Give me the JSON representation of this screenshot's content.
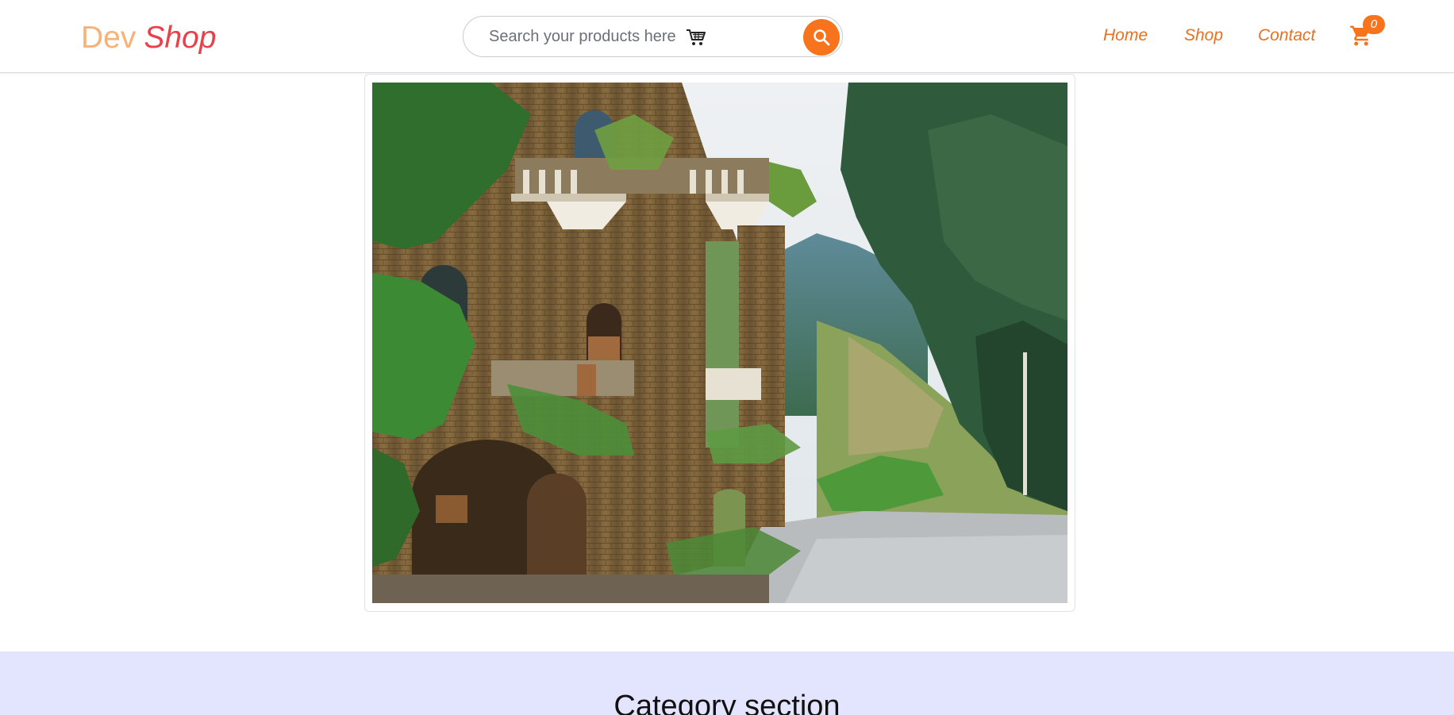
{
  "brand": {
    "part1": "Dev",
    "part2": "Shop"
  },
  "search": {
    "placeholder": "Search your products here",
    "cart_icon": "shopping-cart-icon",
    "button_icon": "search-icon"
  },
  "nav": {
    "links": [
      {
        "label": "Home"
      },
      {
        "label": "Shop"
      },
      {
        "label": "Contact"
      }
    ],
    "cart_icon": "cart-icon",
    "cart_count": "0"
  },
  "hero": {
    "image_icon": "castle-landscape-photo"
  },
  "category": {
    "title": "Category section"
  },
  "colors": {
    "accent": "#f7741c",
    "brand_light": "#f7b27a",
    "brand_red": "#e8414a",
    "nav_link": "#e8701e",
    "category_bg": "#e3e4fd"
  }
}
